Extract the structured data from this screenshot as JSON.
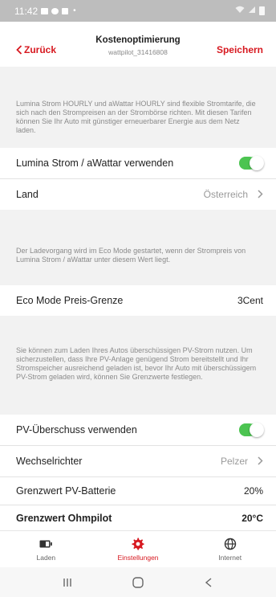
{
  "status_bar": {
    "time": "11:42"
  },
  "header": {
    "back_label": "Zurück",
    "title": "Kostenoptimierung",
    "subtitle": "wattpilot_31416808",
    "save_label": "Speichern"
  },
  "sections": {
    "intro_text": "Lumina Strom HOURLY und aWattar HOURLY sind flexible Stromtarife, die sich nach den Strompreisen an der Strombörse richten. Mit diesen Tarifen können Sie Ihr Auto mit günstiger erneuerbarer Energie aus dem Netz laden.",
    "eco_text": "Der Ladevorgang wird im Eco Mode gestartet, wenn der Strompreis von Lumina Strom / aWattar unter diesem Wert liegt.",
    "pv_text": "Sie können zum Laden Ihres Autos überschüssigen PV-Strom nutzen. Um sicherzustellen, dass Ihre PV-Anlage genügend Strom bereitstellt und Ihr Stromspeicher ausreichend geladen ist, bevor Ihr Auto mit überschüssigem PV-Strom geladen wird, können Sie Grenzwerte festlegen."
  },
  "rows": {
    "lumina_label": "Lumina Strom / aWattar verwenden",
    "lumina_enabled": true,
    "land_label": "Land",
    "land_value": "Österreich",
    "eco_label": "Eco Mode Preis-Grenze",
    "eco_value": "3Cent",
    "pv_label": "PV-Überschuss verwenden",
    "pv_enabled": true,
    "inverter_label": "Wechselrichter",
    "inverter_value": "Pelzer",
    "battery_label": "Grenzwert PV-Batterie",
    "battery_value": "20%",
    "ohmpilot_label": "Grenzwert Ohmpilot",
    "ohmpilot_value": "20°C"
  },
  "tabs": [
    {
      "label": "Laden",
      "icon": "battery-icon",
      "active": false
    },
    {
      "label": "Einstellungen",
      "icon": "gear-icon",
      "active": true
    },
    {
      "label": "Internet",
      "icon": "globe-icon",
      "active": false
    }
  ],
  "colors": {
    "accent": "#d71920",
    "toggle_on": "#4cc451"
  }
}
